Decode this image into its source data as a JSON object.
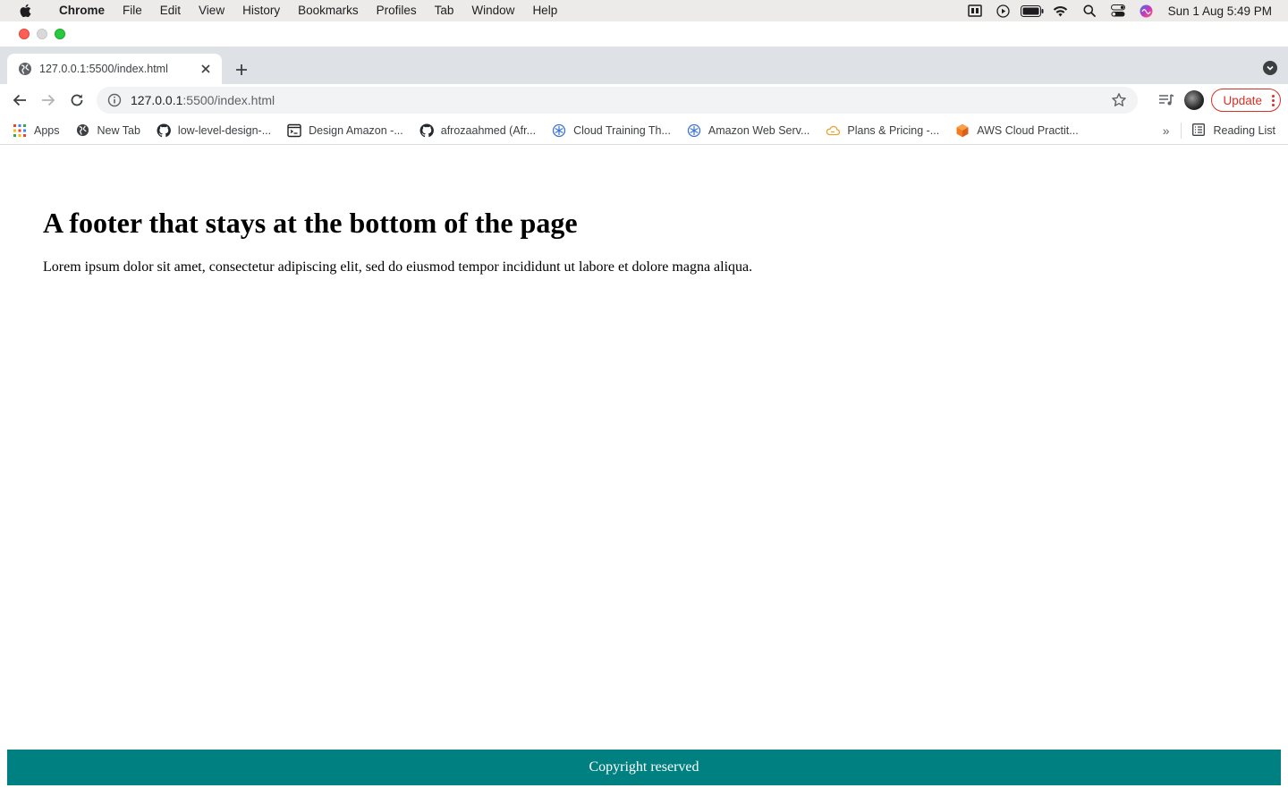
{
  "menubar": {
    "app_name": "Chrome",
    "items": [
      "File",
      "Edit",
      "View",
      "History",
      "Bookmarks",
      "Profiles",
      "Tab",
      "Window",
      "Help"
    ],
    "clock": "Sun 1 Aug  5:49 PM"
  },
  "tab": {
    "title": "127.0.0.1:5500/index.html"
  },
  "omnibox": {
    "url_host": "127.0.0.1",
    "url_path": ":5500/index.html"
  },
  "toolbar": {
    "update_label": "Update"
  },
  "bookmarks": {
    "items": [
      {
        "label": "Apps",
        "icon": "apps-grid-icon"
      },
      {
        "label": "New Tab",
        "icon": "globe-icon"
      },
      {
        "label": "low-level-design-...",
        "icon": "github-icon"
      },
      {
        "label": "Design Amazon -...",
        "icon": "terminal-page-icon"
      },
      {
        "label": "afrozaahmed (Afr...",
        "icon": "github-icon"
      },
      {
        "label": "Cloud Training Th...",
        "icon": "cloud-snowflake-icon"
      },
      {
        "label": "Amazon Web Serv...",
        "icon": "cloud-snowflake-icon"
      },
      {
        "label": "Plans & Pricing -...",
        "icon": "cloud-outline-icon"
      },
      {
        "label": "AWS Cloud Practit...",
        "icon": "aws-cube-icon"
      }
    ],
    "overflow": "»",
    "reading_list": "Reading List"
  },
  "page": {
    "heading": "A footer that stays at the bottom of the page",
    "paragraph": "Lorem ipsum dolor sit amet, consectetur adipiscing elit, sed do eiusmod tempor incididunt ut labore et dolore magna aliqua.",
    "footer": "Copyright reserved"
  },
  "colors": {
    "footer_bg": "#008080",
    "update_accent": "#d93025"
  }
}
